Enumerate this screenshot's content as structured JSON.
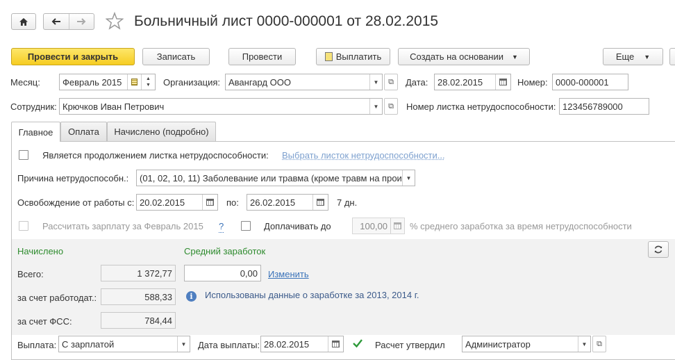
{
  "window": {
    "title": "Больничный лист 0000-000001 от 28.02.2015"
  },
  "toolbar": {
    "post_close": "Провести и закрыть",
    "save": "Записать",
    "post": "Провести",
    "pay": "Выплатить",
    "create_based": "Создать на основании",
    "more": "Еще"
  },
  "header": {
    "month_label": "Месяц:",
    "month_value": "Февраль 2015",
    "org_label": "Организация:",
    "org_value": "Авангард ООО",
    "date_label": "Дата:",
    "date_value": "28.02.2015",
    "number_label": "Номер:",
    "number_value": "0000-000001",
    "employee_label": "Сотрудник:",
    "employee_value": "Крючков Иван Петрович",
    "sheet_number_label": "Номер листка нетрудоспособности:",
    "sheet_number_value": "123456789000"
  },
  "tabs": [
    {
      "label": "Главное",
      "active": true
    },
    {
      "label": "Оплата",
      "active": false
    },
    {
      "label": "Начислено (подробно)",
      "active": false
    }
  ],
  "main": {
    "continuation_label": "Является продолжением листка нетрудоспособности:",
    "continuation_checked": false,
    "choose_sheet_link": "Выбрать листок нетрудоспособности...",
    "reason_label": "Причина нетрудоспособн.:",
    "reason_value": "(01, 02, 10, 11) Заболевание или травма (кроме травм на прои:",
    "release_label": "Освобождение от работы с:",
    "release_from": "20.02.2015",
    "release_to_label": "по:",
    "release_to": "26.02.2015",
    "release_days": "7 дн.",
    "calc_salary_label": "Рассчитать зарплату за Февраль 2015",
    "help_mark": "?",
    "supplement_label": "Доплачивать до",
    "supplement_value": "100,00",
    "supplement_suffix": "% среднего заработка за время нетрудоспособности"
  },
  "accrual": {
    "accrued_title": "Начислено",
    "avg_title": "Средний заработок",
    "total_label": "Всего:",
    "total_value": "1 372,77",
    "avg_value": "0,00",
    "change_link": "Изменить",
    "employer_label": "за счет работодат.:",
    "employer_value": "588,33",
    "info_text": "Использованы данные о заработке за  2013,  2014 г.",
    "fss_label": "за счет ФСС:",
    "fss_value": "784,44"
  },
  "footer": {
    "payment_label": "Выплата:",
    "payment_value": "С зарплатой",
    "pay_date_label": "Дата выплаты:",
    "pay_date_value": "28.02.2015",
    "approved_checked": true,
    "approved_label": "Расчет утвердил",
    "approved_value": "Администратор"
  }
}
